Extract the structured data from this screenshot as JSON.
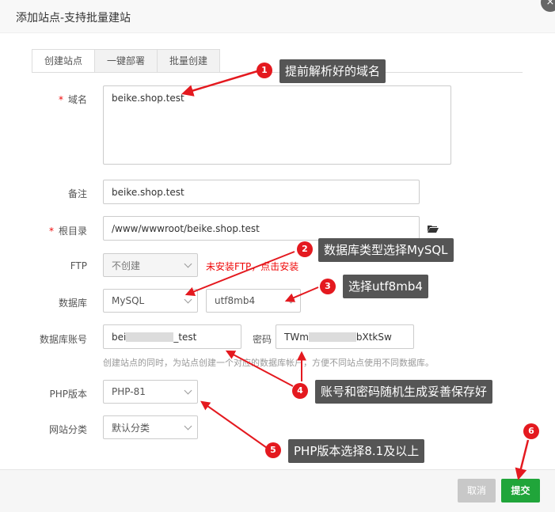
{
  "dialog": {
    "title": "添加站点-支持批量建站",
    "close_icon": "×"
  },
  "tabs": [
    "创建站点",
    "一键部署",
    "批量创建"
  ],
  "form": {
    "domain": {
      "label": "域名",
      "value": "beike.shop.test"
    },
    "remark": {
      "label": "备注",
      "value": "beike.shop.test"
    },
    "root": {
      "label": "根目录",
      "value": "/www/wwwroot/beike.shop.test"
    },
    "ftp": {
      "label": "FTP",
      "value": "不创建",
      "warning": "未安装FTP，点击安装"
    },
    "database": {
      "label": "数据库",
      "type": "MySQL",
      "charset": "utf8mb4"
    },
    "db_account": {
      "label": "数据库账号",
      "value_prefix": "bei",
      "value_suffix": "_test",
      "password_label": "密码",
      "password_prefix": "TWm",
      "password_suffix": "bXtkSw"
    },
    "hint": "创建站点的同时，为站点创建一个对应的数据库帐户，方便不同站点使用不同数据库。",
    "php": {
      "label": "PHP版本",
      "value": "PHP-81"
    },
    "category": {
      "label": "网站分类",
      "value": "默认分类"
    }
  },
  "buttons": {
    "cancel": "取消",
    "submit": "提交"
  },
  "annotations": [
    {
      "n": "1",
      "text": "提前解析好的域名"
    },
    {
      "n": "2",
      "text": "数据库类型选择MySQL"
    },
    {
      "n": "3",
      "text": "选择utf8mb4"
    },
    {
      "n": "4",
      "text": "账号和密码随机生成妥善保存好"
    },
    {
      "n": "5",
      "text": "PHP版本选择8.1及以上"
    },
    {
      "n": "6",
      "text": ""
    }
  ],
  "colors": {
    "accent": "#20a53a",
    "required": "#ef0808",
    "annotation": "#e4191f",
    "callout_bg": "#555555"
  }
}
